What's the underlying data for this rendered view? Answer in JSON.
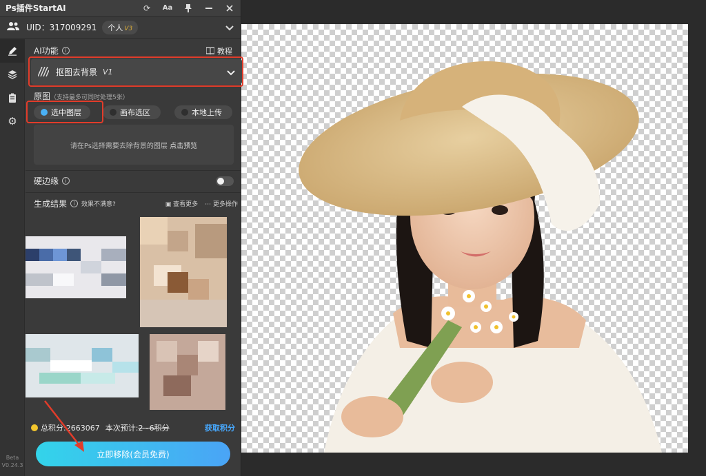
{
  "app": {
    "title": "Ps插件StartAI",
    "titlebar_icons": [
      "refresh-icon",
      "font-icon",
      "pin-icon",
      "minimize-icon",
      "close-icon"
    ]
  },
  "user": {
    "uid_label": "UID：317009291",
    "plan_label": "个人",
    "plan_version": "V3"
  },
  "ai_function": {
    "label": "AI功能",
    "tutorial": "教程",
    "selected": "抠图去背景",
    "selected_version": "V1"
  },
  "source": {
    "label": "原图",
    "hint": "（支持最多可同时处理5张）",
    "options": [
      {
        "label": "选中图层",
        "selected": true
      },
      {
        "label": "画布选区",
        "selected": false
      },
      {
        "label": "本地上传",
        "selected": false
      }
    ],
    "empty_text": "请在Ps选择需要去除背景的图层",
    "preview_link": "点击预览"
  },
  "hard_edge": {
    "label": "硬边缘",
    "enabled": false
  },
  "results": {
    "label": "生成结果",
    "feedback": "效果不满意?",
    "see_more": "查看更多",
    "more_actions": "更多操作"
  },
  "footer": {
    "total_points_label": "总积分:",
    "total_points_value": "2663067",
    "estimate_label": "本次预计:",
    "estimate_value": "2~6积分",
    "get_points": "获取积分",
    "cta": "立即移除(会员免费)"
  },
  "version": {
    "channel": "Beta",
    "number": "V0.24.3"
  },
  "colors": {
    "highlight": "#e23c2a",
    "accent": "#4aa4f6",
    "coin": "#f3c62d"
  }
}
